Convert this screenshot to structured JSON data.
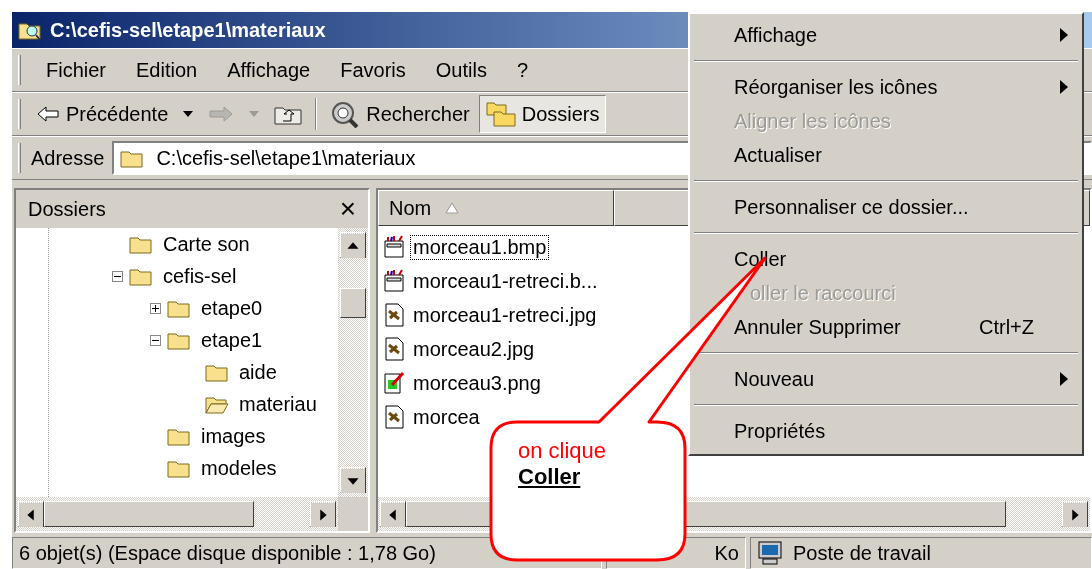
{
  "window": {
    "title": "C:\\cefis-sel\\etape1\\materiaux"
  },
  "menu_bar": [
    "Fichier",
    "Edition",
    "Affichage",
    "Favoris",
    "Outils",
    "?"
  ],
  "toolbar": [
    {
      "kind": "back",
      "label": "Précédente"
    },
    {
      "kind": "forward",
      "disabled": true
    },
    {
      "kind": "up"
    },
    {
      "kind": "search",
      "label": "Rechercher"
    },
    {
      "kind": "folders",
      "label": "Dossiers",
      "selected": true
    }
  ],
  "address": {
    "label": "Adresse",
    "value": "C:\\cefis-sel\\etape1\\materiaux"
  },
  "folders_pane": {
    "title": "Dossiers",
    "close": "×",
    "tree": [
      {
        "label": "Carte son"
      },
      {
        "label": "cefis-sel",
        "expanded": true,
        "children": [
          {
            "label": "etape0",
            "expanded": false
          },
          {
            "label": "etape1",
            "expanded": true,
            "children": [
              {
                "label": "aide",
                "selected": false
              },
              {
                "label": "materiau",
                "selected": true
              }
            ]
          },
          {
            "label": "images"
          },
          {
            "label": "modeles"
          }
        ]
      }
    ]
  },
  "files": {
    "columns": [
      "Nom"
    ],
    "items": [
      {
        "name": "morceau1.bmp",
        "kind": "bmp",
        "focused": true
      },
      {
        "name": "morceau1-retreci.b...",
        "kind": "bmp",
        "focused": false
      },
      {
        "name": "morceau1-retreci.jpg",
        "kind": "jpg",
        "focused": false
      },
      {
        "name": "morceau2.jpg",
        "kind": "jpg",
        "focused": false
      },
      {
        "name": "morceau3.png",
        "kind": "png",
        "focused": false
      },
      {
        "name": "morcea",
        "kind": "jpg",
        "focused": false
      }
    ]
  },
  "status_bar": [
    "6 objet(s) (Espace disque disponible : 1,78 Go)",
    "Ko",
    "Poste de travail"
  ],
  "context_menu": [
    {
      "kind": "item",
      "label": "Affichage",
      "submenu": true,
      "disabled": false
    },
    {
      "kind": "separator"
    },
    {
      "kind": "item",
      "label": "Réorganiser les icônes",
      "submenu": true,
      "disabled": false
    },
    {
      "kind": "item",
      "label": "Aligner les icônes",
      "submenu": false,
      "disabled": true
    },
    {
      "kind": "item",
      "label": "Actualiser",
      "submenu": false,
      "disabled": false
    },
    {
      "kind": "separator"
    },
    {
      "kind": "item",
      "label": "Personnaliser ce dossier...",
      "submenu": false,
      "disabled": false
    },
    {
      "kind": "separator"
    },
    {
      "kind": "item",
      "label": "Coller",
      "submenu": false,
      "disabled": false
    },
    {
      "kind": "item",
      "label": "oller le raccourci",
      "submenu": false,
      "disabled": true,
      "partly_covered": true
    },
    {
      "kind": "item",
      "label": "Annuler Supprimer",
      "shortcut": "Ctrl+Z",
      "submenu": false,
      "disabled": false
    },
    {
      "kind": "separator"
    },
    {
      "kind": "item",
      "label": "Nouveau",
      "submenu": true,
      "disabled": false
    },
    {
      "kind": "separator"
    },
    {
      "kind": "item",
      "label": "Propriétés",
      "submenu": false,
      "disabled": false
    }
  ],
  "callout": {
    "line1": "on clique",
    "line2": "Coller"
  }
}
